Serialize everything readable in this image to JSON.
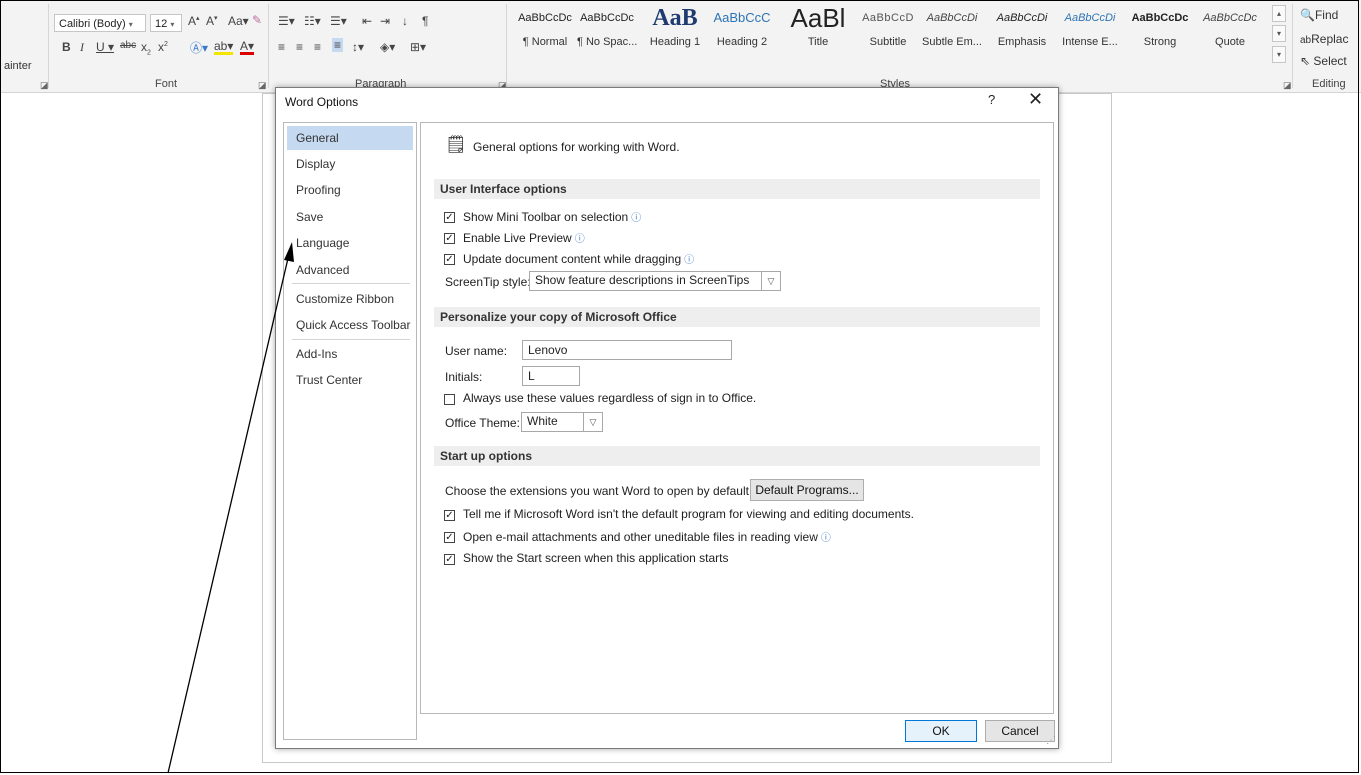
{
  "ribbon": {
    "format_painter_partial": "ainter",
    "font_name": "Calibri (Body)",
    "font_size": "12",
    "font_group_label": "Font",
    "paragraph_group_label": "Paragraph",
    "styles_group_label": "Styles",
    "editing_group_label": "Editing",
    "styles": [
      {
        "sample": "AaBbCcDc",
        "name": "¶ Normal"
      },
      {
        "sample": "AaBbCcDc",
        "name": "¶ No Spac..."
      },
      {
        "sample": "AaB",
        "name": "Heading 1"
      },
      {
        "sample": "AaBbCcC",
        "name": "Heading 2"
      },
      {
        "sample": "AaBl",
        "name": "Title"
      },
      {
        "sample": "AaBbCcD",
        "name": "Subtitle"
      },
      {
        "sample": "AaBbCcDi",
        "name": "Subtle Em..."
      },
      {
        "sample": "AaBbCcDi",
        "name": "Emphasis"
      },
      {
        "sample": "AaBbCcDi",
        "name": "Intense E..."
      },
      {
        "sample": "AaBbCcDc",
        "name": "Strong"
      },
      {
        "sample": "AaBbCcDc",
        "name": "Quote"
      }
    ],
    "editing": {
      "find": "Find",
      "replace": "Replac",
      "select": "Select"
    }
  },
  "dialog": {
    "title": "Word Options",
    "help": "?",
    "close": "✕",
    "nav": [
      "General",
      "Display",
      "Proofing",
      "Save",
      "Language",
      "Advanced",
      "Customize Ribbon",
      "Quick Access Toolbar",
      "Add-Ins",
      "Trust Center"
    ],
    "selected_nav": "General",
    "header_text": "General options for working with Word.",
    "ui_section": {
      "title": "User Interface options",
      "show_mini_toolbar": "Show Mini Toolbar on selection",
      "enable_live_preview": "Enable Live Preview",
      "update_while_dragging": "Update document content while dragging",
      "screentip_label": "ScreenTip style:",
      "screentip_value": "Show feature descriptions in ScreenTips"
    },
    "personalize_section": {
      "title": "Personalize your copy of Microsoft Office",
      "username_label": "User name:",
      "username_value": "Lenovo",
      "initials_label": "Initials:",
      "initials_value": "L",
      "always_use": "Always use these values regardless of sign in to Office.",
      "theme_label": "Office Theme:",
      "theme_value": "White"
    },
    "startup_section": {
      "title": "Start up options",
      "extensions_label": "Choose the extensions you want Word to open by default:",
      "default_programs_button": "Default Programs...",
      "tell_me_default": "Tell me if Microsoft Word isn't the default program for viewing and editing documents.",
      "open_reading_view": "Open e-mail attachments and other uneditable files in reading view",
      "show_start_screen": "Show the Start screen when this application starts"
    },
    "ok_button": "OK",
    "cancel_button": "Cancel"
  },
  "colors": {
    "selected_nav": "#c5d9f0",
    "ok_border": "#0078d7",
    "info_icon": "#3b78c8"
  }
}
